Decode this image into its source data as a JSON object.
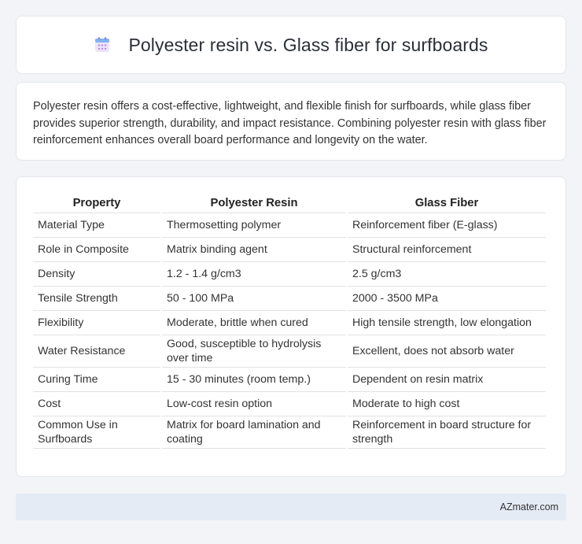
{
  "header": {
    "title": "Polyester resin vs. Glass fiber for surfboards",
    "icon": "calendar-icon"
  },
  "summary": {
    "text": "Polyester resin offers a cost-effective, lightweight, and flexible finish for surfboards, while glass fiber provides superior strength, durability, and impact resistance. Combining polyester resin with glass fiber reinforcement enhances overall board performance and longevity on the water."
  },
  "table": {
    "headers": [
      "Property",
      "Polyester Resin",
      "Glass Fiber"
    ],
    "rows": [
      [
        "Material Type",
        "Thermosetting polymer",
        "Reinforcement fiber (E-glass)"
      ],
      [
        "Role in Composite",
        "Matrix binding agent",
        "Structural reinforcement"
      ],
      [
        "Density",
        "1.2 - 1.4 g/cm3",
        "2.5 g/cm3"
      ],
      [
        "Tensile Strength",
        "50 - 100 MPa",
        "2000 - 3500 MPa"
      ],
      [
        "Flexibility",
        "Moderate, brittle when cured",
        "High tensile strength, low elongation"
      ],
      [
        "Water Resistance",
        "Good, susceptible to hydrolysis over time",
        "Excellent, does not absorb water"
      ],
      [
        "Curing Time",
        "15 - 30 minutes (room temp.)",
        "Dependent on resin matrix"
      ],
      [
        "Cost",
        "Low-cost resin option",
        "Moderate to high cost"
      ],
      [
        "Common Use in Surfboards",
        "Matrix for board lamination and coating",
        "Reinforcement in board structure for strength"
      ]
    ]
  },
  "footer": {
    "text": "AZmater.com"
  }
}
